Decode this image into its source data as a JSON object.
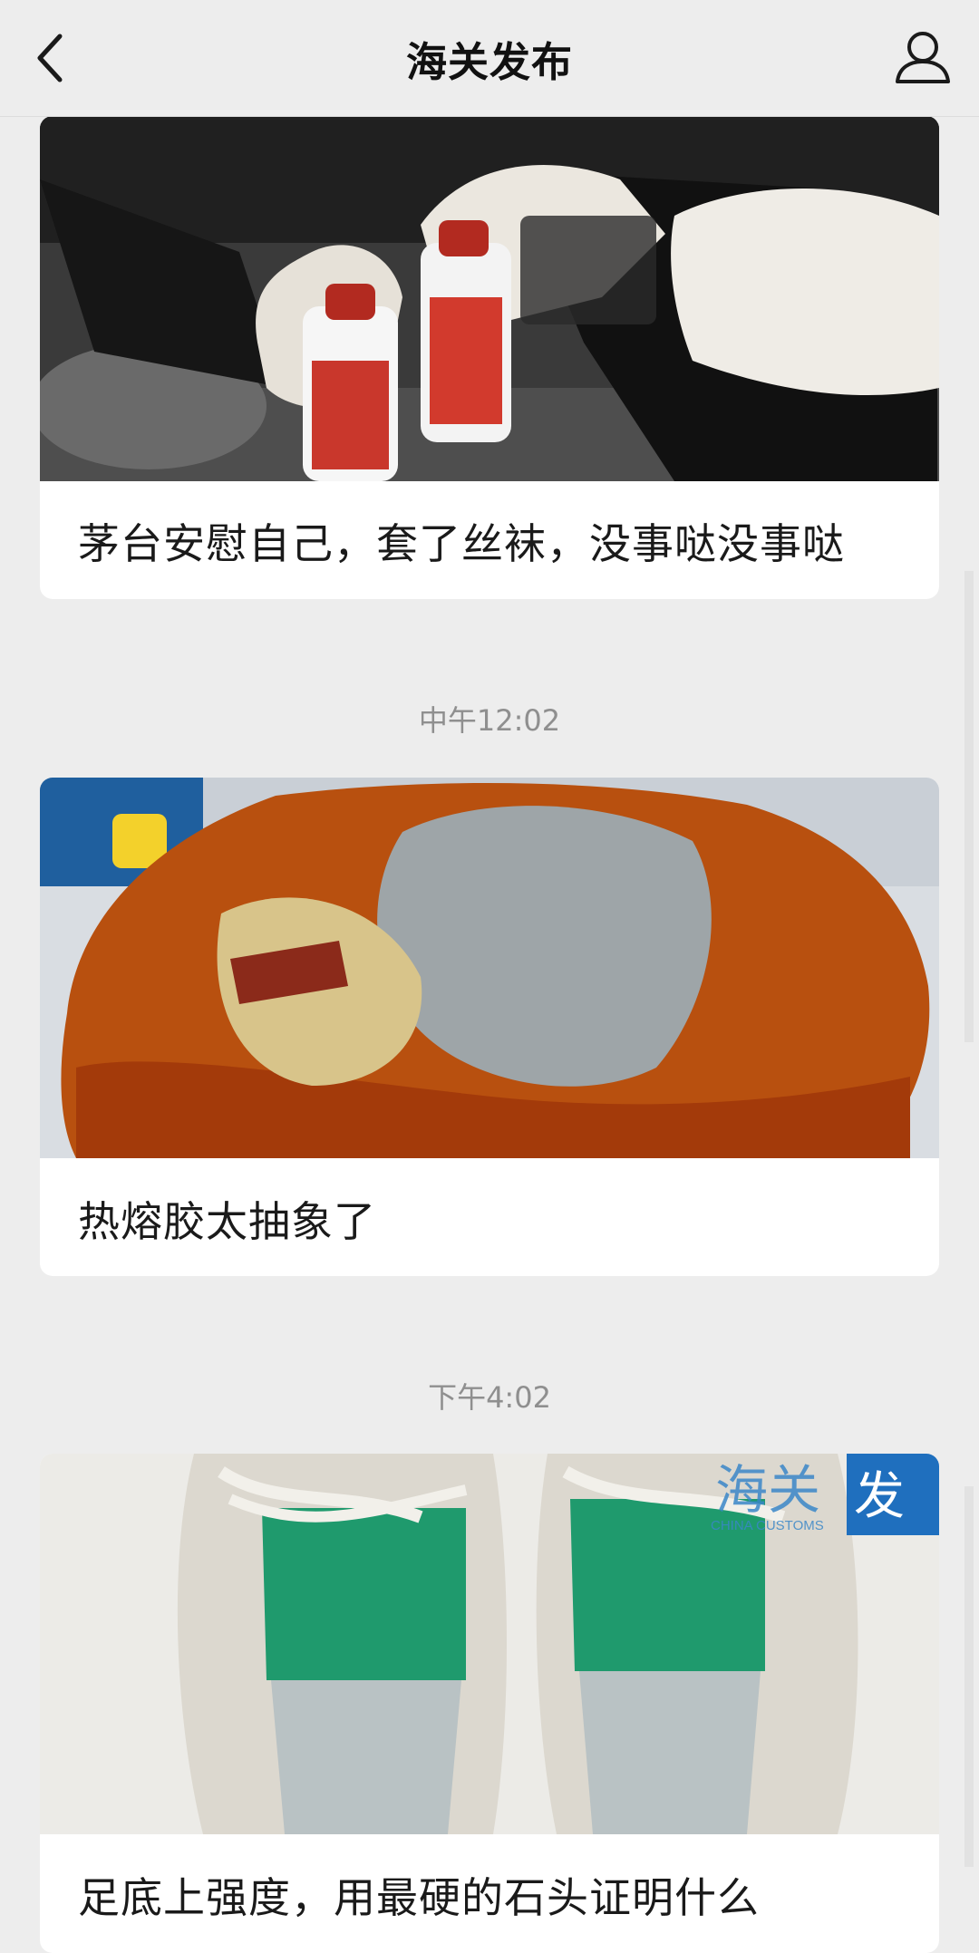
{
  "header": {
    "title": "海关发布",
    "back_icon": "chevron-left-icon",
    "profile_icon": "user-icon"
  },
  "messages": [
    {
      "caption": "茅台安慰自己，套了丝袜，没事哒没事哒",
      "image": "gloved-hands-holding-moutai-bottles"
    },
    {
      "timestamp": "中午12:02",
      "caption": "热熔胶太抽象了",
      "image": "amber-hot-melt-glue-lump"
    },
    {
      "timestamp": "下午4:02",
      "caption": "足底上强度，用最硬的石头证明什么",
      "image": "sneakers-with-green-insoles",
      "watermark": "海关发布 CHINA CUSTOMS"
    }
  ],
  "colors": {
    "background": "#ededed",
    "card": "#ffffff",
    "text": "#1a1a1a",
    "timestamp": "#8f8f8f"
  }
}
